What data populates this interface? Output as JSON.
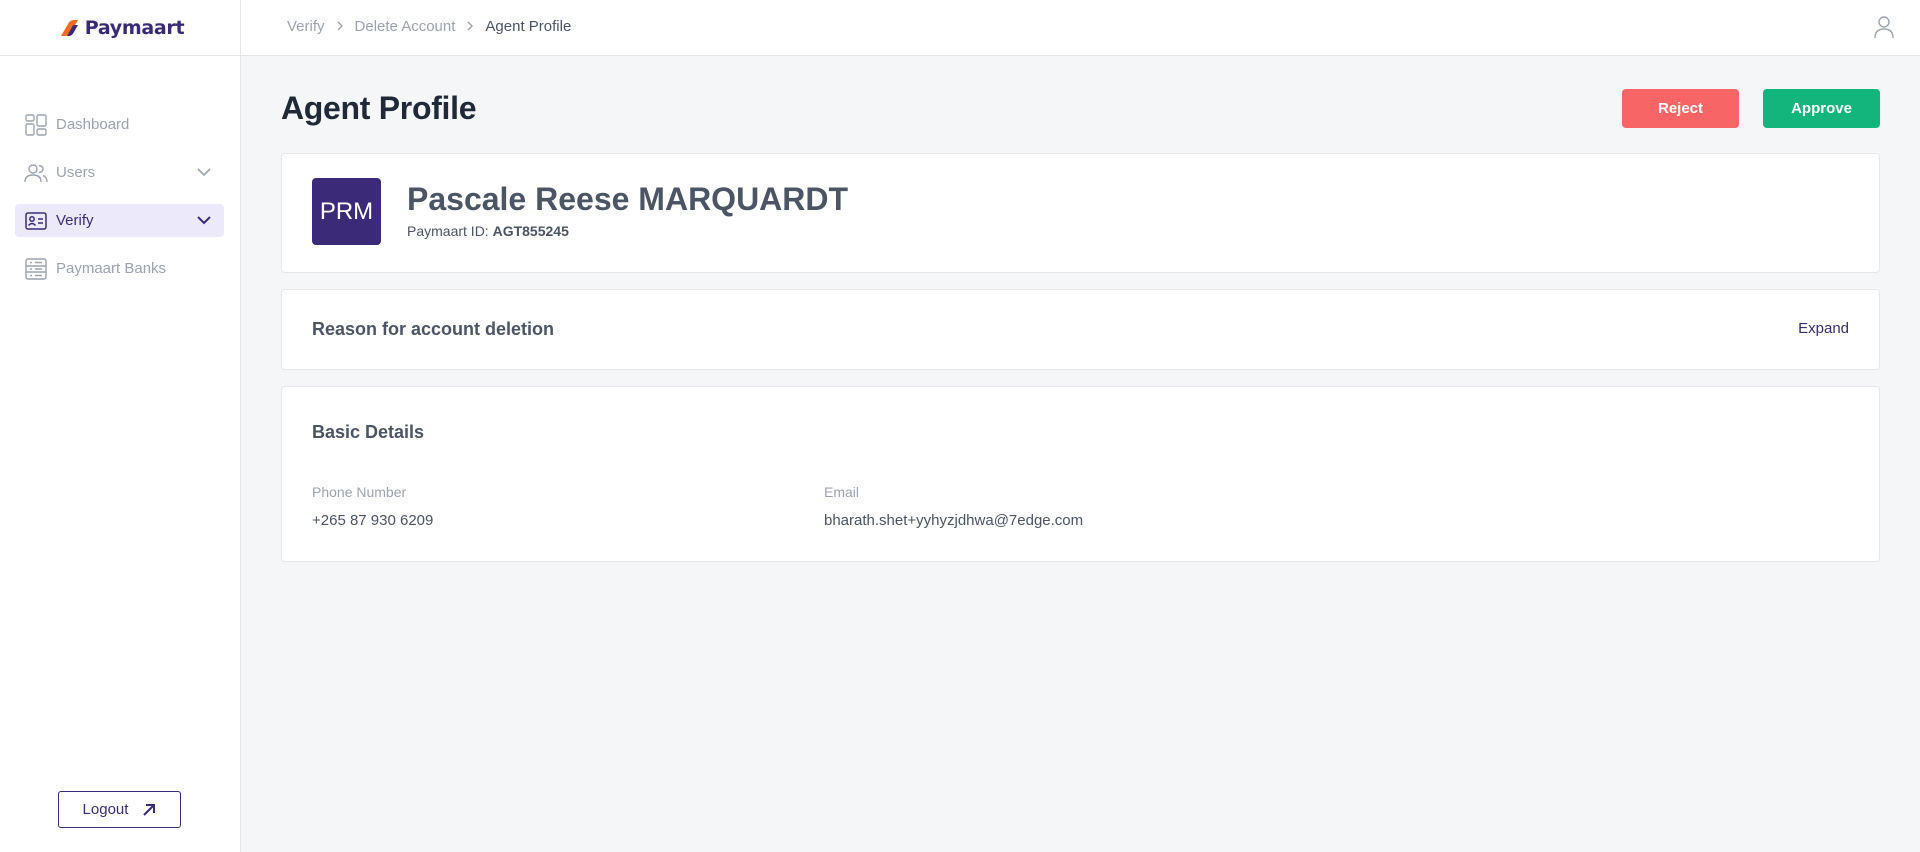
{
  "app": {
    "brand": "Paymaart"
  },
  "sidebar": {
    "items": [
      {
        "label": "Dashboard",
        "icon": "dashboard-icon"
      },
      {
        "label": "Users",
        "icon": "users-icon"
      },
      {
        "label": "Verify",
        "icon": "id-card-icon",
        "active": true
      },
      {
        "label": "Paymaart Banks",
        "icon": "bank-list-icon"
      }
    ],
    "logout_label": "Logout"
  },
  "header": {
    "breadcrumbs": [
      "Verify",
      "Delete Account",
      "Agent Profile"
    ]
  },
  "page": {
    "title": "Agent Profile",
    "reject_label": "Reject",
    "approve_label": "Approve"
  },
  "profile": {
    "initials": "PRM",
    "name": "Pascale Reese MARQUARDT",
    "id_label": "Paymaart ID:",
    "id_value": "AGT855245"
  },
  "reason": {
    "title": "Reason for account deletion",
    "expand_label": "Expand"
  },
  "details": {
    "title": "Basic Details",
    "phone_label": "Phone Number",
    "phone_value": "+265 87 930 6209",
    "email_label": "Email",
    "email_value": "bharath.shet+yyhyzjdhwa@7edge.com"
  },
  "colors": {
    "brand": "#3b2a78",
    "reject": "#f76567",
    "approve": "#12b57c",
    "logo_orange": "#f26b21"
  }
}
